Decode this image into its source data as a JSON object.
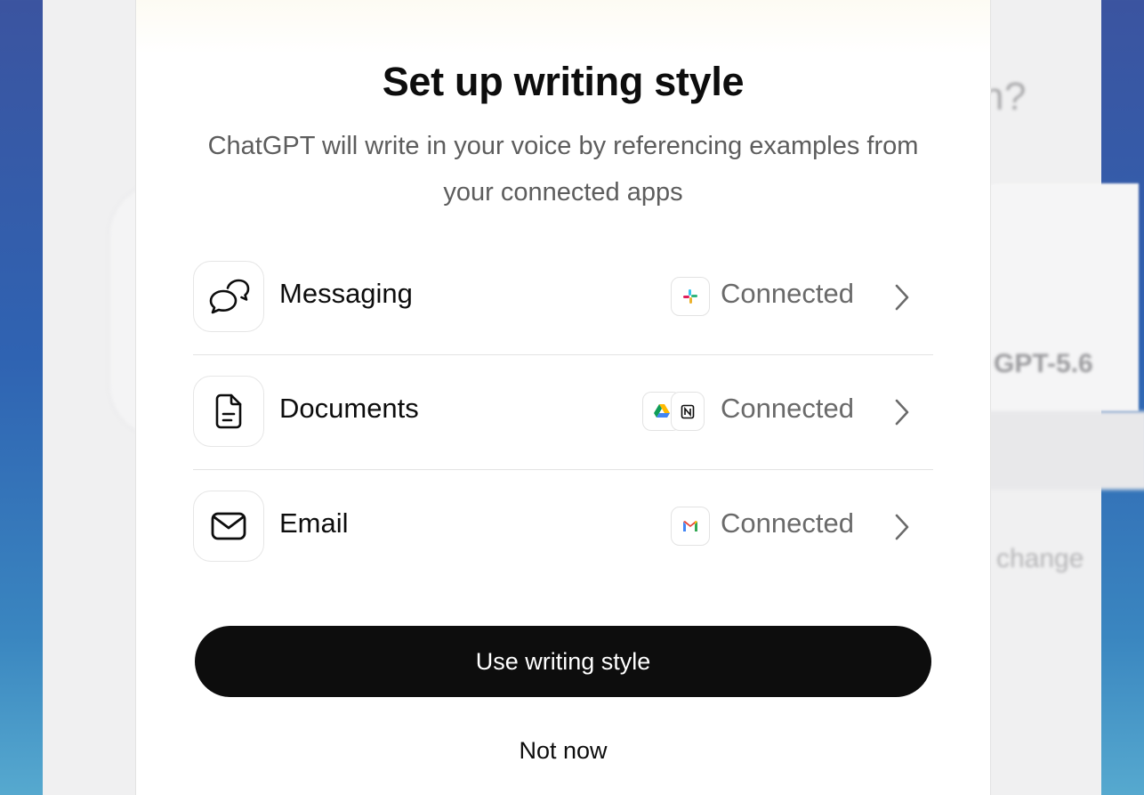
{
  "background": {
    "heading_fragment": "n?",
    "model_fragment": "GPT-5.6",
    "change_fragment": "change"
  },
  "modal": {
    "title": "Set up writing style",
    "subtitle": "ChatGPT will write in your voice by referencing examples from your connected apps",
    "rows": [
      {
        "label": "Messaging",
        "icon": "chat-bubbles-icon",
        "apps": [
          "slack-icon"
        ],
        "status": "Connected"
      },
      {
        "label": "Documents",
        "icon": "document-icon",
        "apps": [
          "google-drive-icon",
          "notion-icon"
        ],
        "status": "Connected"
      },
      {
        "label": "Email",
        "icon": "envelope-icon",
        "apps": [
          "gmail-icon"
        ],
        "status": "Connected"
      }
    ],
    "primary_button": "Use writing style",
    "secondary_button": "Not now"
  },
  "colors": {
    "primary_button_bg": "#0d0d0d",
    "status_text": "#6a6a6a",
    "subtitle_text": "#5d5d5d"
  }
}
